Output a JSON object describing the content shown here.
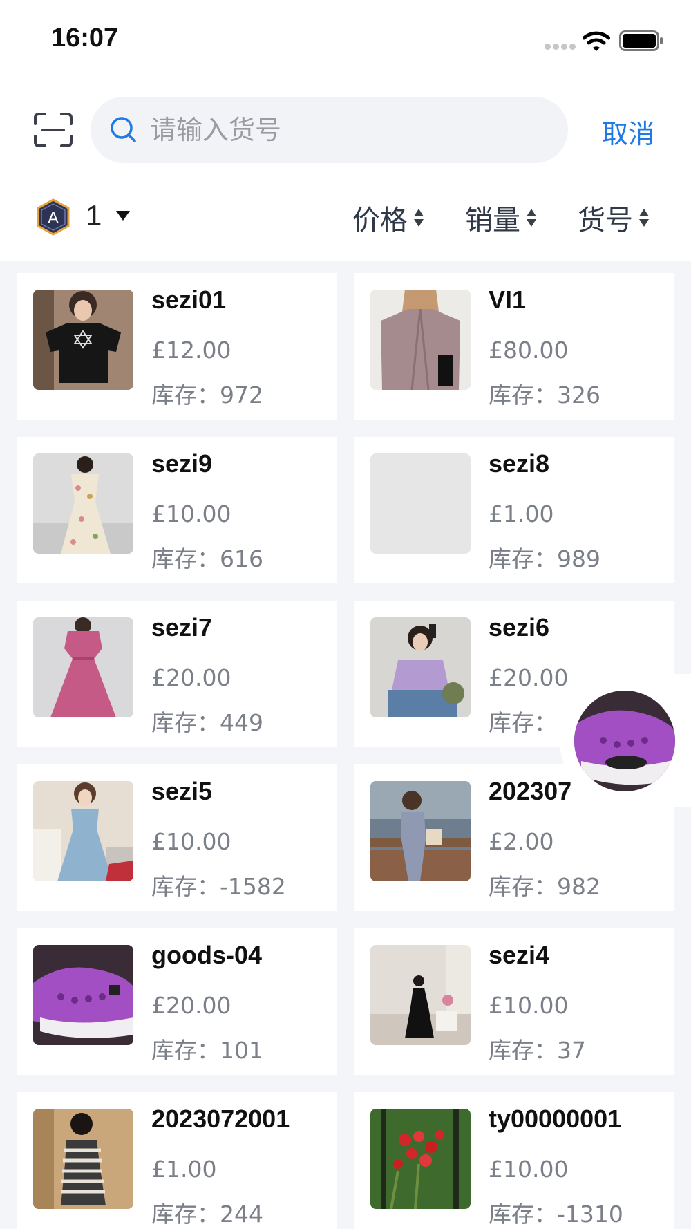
{
  "status_bar": {
    "time": "16:07"
  },
  "search": {
    "placeholder": "请输入货号",
    "value": "",
    "cancel_label": "取消"
  },
  "filter": {
    "store_badge_letter": "A",
    "store_number": "1",
    "sorts": [
      {
        "label": "价格"
      },
      {
        "label": "销量"
      },
      {
        "label": "货号"
      }
    ]
  },
  "products": [
    {
      "name": "sezi01",
      "price": "£12.00",
      "stock_label": "库存：",
      "stock": "972",
      "image": "black-tshirt"
    },
    {
      "name": "VI1",
      "price": "£80.00",
      "stock_label": "库存：",
      "stock": "326",
      "image": "mauve-blazer"
    },
    {
      "name": "sezi9",
      "price": "£10.00",
      "stock_label": "库存：",
      "stock": "616",
      "image": "floral-dress"
    },
    {
      "name": "sezi8",
      "price": "£1.00",
      "stock_label": "库存：",
      "stock": "989",
      "image": "placeholder"
    },
    {
      "name": "sezi7",
      "price": "£20.00",
      "stock_label": "库存：",
      "stock": "449",
      "image": "pink-dress"
    },
    {
      "name": "sezi6",
      "price": "£20.00",
      "stock_label": "库存：",
      "stock": "",
      "image": "lavender-cardigan"
    },
    {
      "name": "sezi5",
      "price": "£10.00",
      "stock_label": "库存：",
      "stock": "-1582",
      "image": "denim-dress"
    },
    {
      "name": "202307",
      "price": "£2.00",
      "stock_label": "库存：",
      "stock": "982",
      "image": "woman-on-bench"
    },
    {
      "name": "goods-04",
      "price": "£20.00",
      "stock_label": "库存：",
      "stock": "101",
      "image": "purple-sneaker"
    },
    {
      "name": "sezi4",
      "price": "£10.00",
      "stock_label": "库存：",
      "stock": "37",
      "image": "black-dress-room"
    },
    {
      "name": "2023072001",
      "price": "£1.00",
      "stock_label": "库存：",
      "stock": "244",
      "image": "striped-dress"
    },
    {
      "name": "ty00000001",
      "price": "£10.00",
      "stock_label": "库存：",
      "stock": "-1310",
      "image": "red-flowers"
    }
  ],
  "floating_button": {
    "image": "purple-sneaker"
  },
  "colors": {
    "accent": "#1f7ae6",
    "page_bg": "#f4f5f9",
    "search_bg": "#f1f3f7",
    "muted_text": "#7b7f88"
  }
}
